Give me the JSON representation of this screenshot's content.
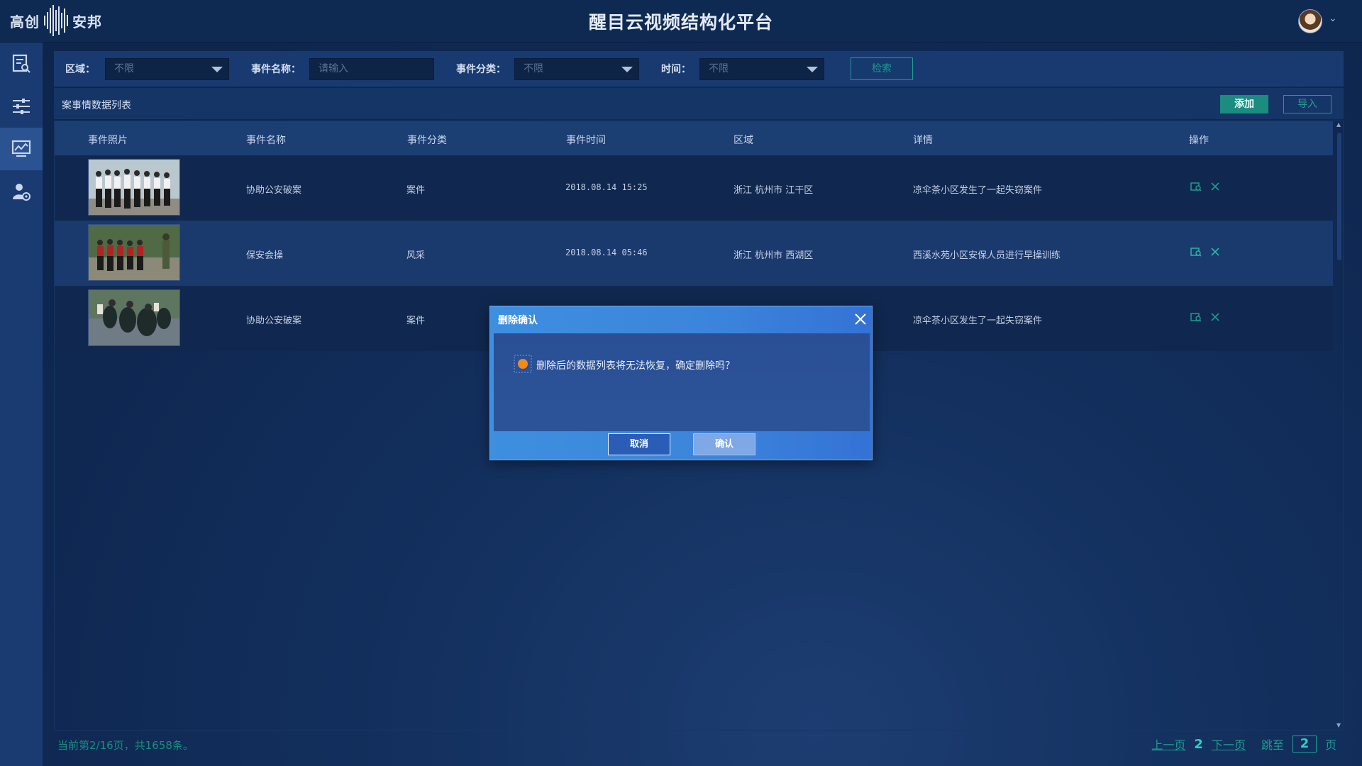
{
  "header": {
    "logo_left": "高创",
    "logo_right": "安邦",
    "title": "醒目云视频结构化平台"
  },
  "sidebar": {
    "items": [
      {
        "icon": "report-icon",
        "active": false
      },
      {
        "icon": "sliders-icon",
        "active": false
      },
      {
        "icon": "monitor-chart-icon",
        "active": true
      },
      {
        "icon": "user-settings-icon",
        "active": false
      }
    ]
  },
  "filters": {
    "region_label": "区域：",
    "region_value": "不限",
    "name_label": "事件名称：",
    "name_placeholder": "请输入",
    "category_label": "事件分类：",
    "category_value": "不限",
    "time_label": "时间：",
    "time_value": "不限",
    "search_label": "检索"
  },
  "list": {
    "title": "案事情数据列表",
    "add_label": "添加",
    "import_label": "导入",
    "columns": [
      "事件照片",
      "事件名称",
      "事件分类",
      "事件时间",
      "区域",
      "详情",
      "操作"
    ],
    "rows": [
      {
        "name": "协助公安破案",
        "category": "案件",
        "time": "2018.08.14 15:25",
        "region": "浙江 杭州市 江干区",
        "detail": "凉伞茶小区发生了一起失窃案件",
        "photo": "guards-line"
      },
      {
        "name": "保安会操",
        "category": "风采",
        "time": "2018.08.14 05:46",
        "region": "浙江 杭州市 西湖区",
        "detail": "西溪水苑小区安保人员进行早操训练",
        "photo": "guards-drill"
      },
      {
        "name": "协助公安破案",
        "category": "案件",
        "time": "",
        "region": "",
        "detail": "凉伞茶小区发生了一起失窃案件",
        "photo": "crowd-scene"
      }
    ]
  },
  "pagination": {
    "info": "当前第2/16页，共1658条。",
    "prev": "上一页",
    "current": "2",
    "next": "下一页",
    "jump_label": "跳至",
    "jump_value": "2",
    "page_suffix": "页"
  },
  "modal": {
    "title": "删除确认",
    "message": "删除后的数据列表将无法恢复，确定删除吗？",
    "cancel": "取消",
    "confirm": "确认"
  },
  "colors": {
    "accent": "#1a8c80",
    "modal_blue": "#3b84db",
    "warning": "#f08a1c"
  }
}
